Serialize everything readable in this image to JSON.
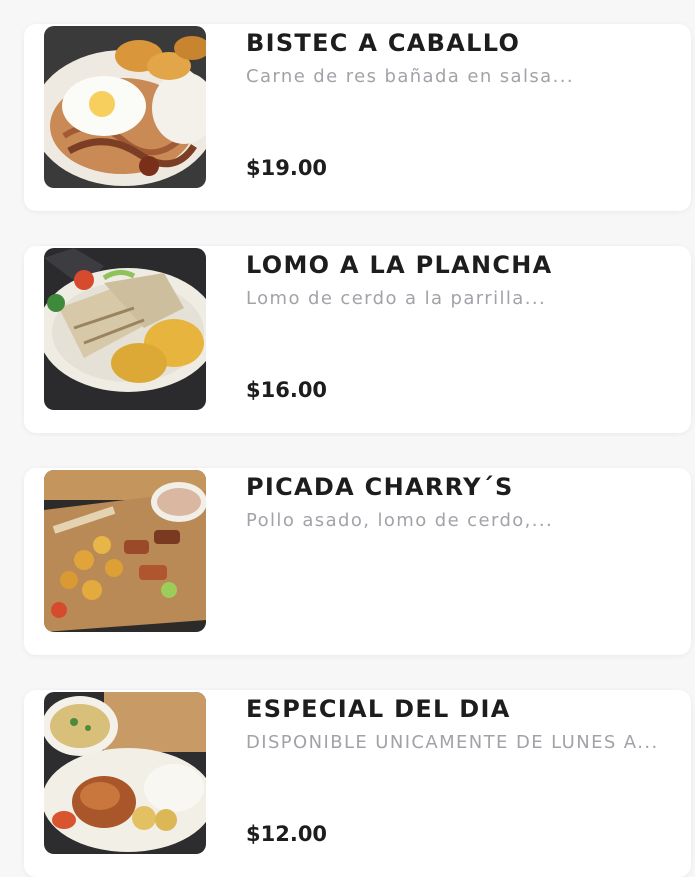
{
  "menu": {
    "items": [
      {
        "title": "BISTEC A CABALLO",
        "description": "Carne de res bañada en salsa...",
        "price": "$19.00",
        "image": "bistec-a-caballo-photo"
      },
      {
        "title": "LOMO A LA PLANCHA",
        "description": "Lomo de cerdo a la parrilla...",
        "price": "$16.00",
        "image": "lomo-a-la-plancha-photo"
      },
      {
        "title": "PICADA CHARRY´S",
        "description": "Pollo asado, lomo de cerdo,...",
        "price": "",
        "image": "picada-charrys-photo"
      },
      {
        "title": "ESPECIAL DEL DIA",
        "description": "DISPONIBLE UNICAMENTE DE LUNES A...",
        "price": "$12.00",
        "image": "especial-del-dia-photo"
      }
    ]
  },
  "colors": {
    "background": "#f7f7f8",
    "card": "#ffffff",
    "title": "#1d1d1d",
    "description": "#a2a2a8",
    "price": "#1d1d1d"
  }
}
